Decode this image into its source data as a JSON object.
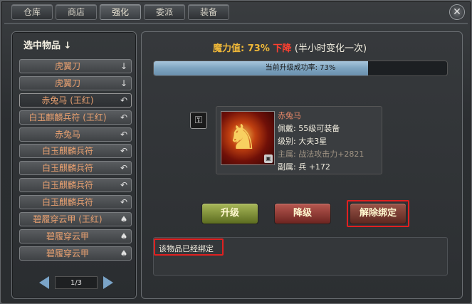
{
  "tabs": [
    {
      "label": "仓库",
      "active": false
    },
    {
      "label": "商店",
      "active": false
    },
    {
      "label": "强化",
      "active": true
    },
    {
      "label": "委派",
      "active": false
    },
    {
      "label": "装备",
      "active": false
    }
  ],
  "close_icon": "close-x",
  "left": {
    "title": "选中物品 ↓",
    "items": [
      {
        "label": "虎翼刀",
        "icon": "↓",
        "selected": false
      },
      {
        "label": "虎翼刀",
        "icon": "↓",
        "selected": false
      },
      {
        "label": "赤兔马 (王红)",
        "icon": "↶",
        "selected": true
      },
      {
        "label": "白玉麒麟兵符 (王红)",
        "icon": "↶",
        "selected": false
      },
      {
        "label": "赤兔马",
        "icon": "↶",
        "selected": false
      },
      {
        "label": "白玉麒麟兵符",
        "icon": "↶",
        "selected": false
      },
      {
        "label": "白玉麒麟兵符",
        "icon": "↶",
        "selected": false
      },
      {
        "label": "白玉麒麟兵符",
        "icon": "↶",
        "selected": false
      },
      {
        "label": "白玉麒麟兵符",
        "icon": "↶",
        "selected": false
      },
      {
        "label": "碧履穿云甲 (王红)",
        "icon": "♠",
        "selected": false
      },
      {
        "label": "碧履穿云甲",
        "icon": "♠",
        "selected": false
      },
      {
        "label": "碧履穿云甲",
        "icon": "♠",
        "selected": false
      }
    ],
    "pager": "1/3"
  },
  "right": {
    "magic_label": "魔力值: 73%",
    "magic_trend": "下降",
    "magic_note": "(半小时变化一次)",
    "success_text": "当前升级成功率: 73%",
    "success_rate": 0.73,
    "item": {
      "name": "赤兔马",
      "requirement": "佩戴: 55级可装备",
      "level": "级别: 大夫3星",
      "main_attr": "主属: 战法攻击力+2821",
      "sub_attr": "副属: 兵 +172"
    },
    "buttons": {
      "upgrade": "升级",
      "downgrade": "降级",
      "unbind": "解除绑定"
    },
    "message": "该物品已经绑定"
  }
}
